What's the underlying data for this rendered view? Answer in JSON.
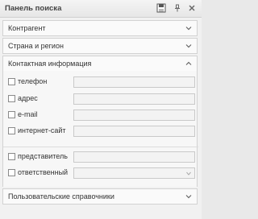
{
  "panel": {
    "title": "Панель поиска",
    "icons": [
      "save-icon",
      "pin-icon",
      "close-icon"
    ]
  },
  "sections": {
    "counterparty": "Контрагент",
    "country_region": "Страна и регион",
    "contact_info": "Контактная информация",
    "custom_refs": "Пользовательские справочники"
  },
  "contact_fields": {
    "phone": "телефон",
    "address": "адрес",
    "email": "e-mail",
    "website": "интернет-сайт"
  },
  "responsible_fields": {
    "representative": "представитель",
    "responsible": "ответственный"
  }
}
